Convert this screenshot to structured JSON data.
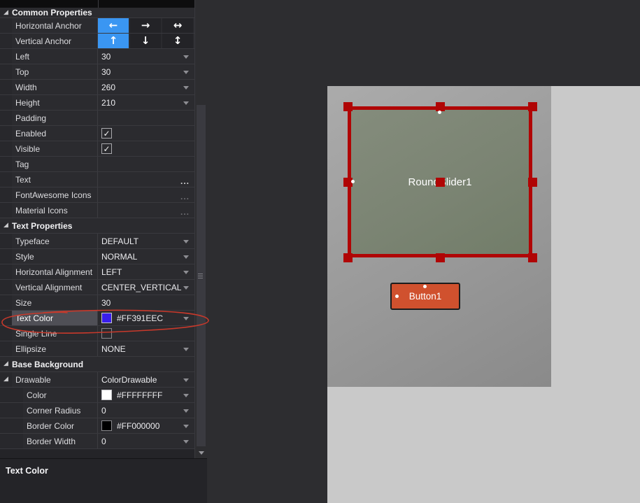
{
  "property_grid": {
    "sections": [
      {
        "label": "Common Properties",
        "rows": [
          {
            "label": "Horizontal Anchor",
            "type": "anchor",
            "buttons": [
              {
                "icon": "anchor-left",
                "glyph": "←",
                "selected": true
              },
              {
                "icon": "anchor-right",
                "glyph": "→",
                "selected": false
              },
              {
                "icon": "anchor-left-right",
                "glyph": "↔",
                "selected": false
              }
            ]
          },
          {
            "label": "Vertical Anchor",
            "type": "anchor",
            "buttons": [
              {
                "icon": "anchor-top",
                "glyph": "↑",
                "selected": true
              },
              {
                "icon": "anchor-bottom",
                "glyph": "↓",
                "selected": false
              },
              {
                "icon": "anchor-top-bottom",
                "glyph": "↕",
                "selected": false
              }
            ]
          },
          {
            "label": "Left",
            "type": "text",
            "value": "30",
            "dropdown": true
          },
          {
            "label": "Top",
            "type": "text",
            "value": "30",
            "dropdown": true
          },
          {
            "label": "Width",
            "type": "text",
            "value": "260",
            "dropdown": true
          },
          {
            "label": "Height",
            "type": "text",
            "value": "210",
            "dropdown": true
          },
          {
            "label": "Padding",
            "type": "empty"
          },
          {
            "label": "Enabled",
            "type": "checkbox",
            "checked": true
          },
          {
            "label": "Visible",
            "type": "checkbox",
            "checked": true
          },
          {
            "label": "Tag",
            "type": "empty"
          },
          {
            "label": "Text",
            "type": "ellipsis",
            "dim": false
          },
          {
            "label": "FontAwesome Icons",
            "type": "ellipsis",
            "dim": true
          },
          {
            "label": "Material Icons",
            "type": "ellipsis",
            "dim": true
          }
        ]
      },
      {
        "label": "Text Properties",
        "rows": [
          {
            "label": "Typeface",
            "type": "text",
            "value": "DEFAULT",
            "dropdown": true
          },
          {
            "label": "Style",
            "type": "text",
            "value": "NORMAL",
            "dropdown": true
          },
          {
            "label": "Horizontal Alignment",
            "type": "text",
            "value": "LEFT",
            "dropdown": true
          },
          {
            "label": "Vertical Alignment",
            "type": "text",
            "value": "CENTER_VERTICAL",
            "dropdown": true
          },
          {
            "label": "Size",
            "type": "text",
            "value": "30",
            "dropdown": false
          },
          {
            "label": "Text Color",
            "type": "color",
            "value": "#FF391EEC",
            "swatch": "#391EEC",
            "dropdown": true,
            "selected": true
          },
          {
            "label": "Single Line",
            "type": "checkbox",
            "checked": false
          },
          {
            "label": "Ellipsize",
            "type": "text",
            "value": "NONE",
            "dropdown": true
          }
        ]
      },
      {
        "label": "Base Background",
        "rows": [
          {
            "label": "Drawable",
            "type": "text",
            "value": "ColorDrawable",
            "dropdown": true,
            "expander": true
          },
          {
            "label": "Color",
            "type": "color",
            "value": "#FFFFFFFF",
            "swatch": "#FFFFFF",
            "dropdown": true,
            "indent": 1
          },
          {
            "label": "Corner Radius",
            "type": "text",
            "value": "0",
            "dropdown": true,
            "indent": 1
          },
          {
            "label": "Border Color",
            "type": "color",
            "value": "#FF000000",
            "swatch": "#000000",
            "dropdown": true,
            "indent": 1
          },
          {
            "label": "Border Width",
            "type": "text",
            "value": "0",
            "dropdown": true,
            "indent": 1
          }
        ]
      }
    ],
    "expander_glyph": "◢",
    "check_glyph": "✓",
    "ellipsis_glyph": "..."
  },
  "description_panel": {
    "text": "Text Color"
  },
  "canvas": {
    "controls": [
      {
        "label": "RoundSlider1",
        "type": "round-slider",
        "selected": true
      },
      {
        "label": "Button1",
        "type": "button"
      }
    ]
  },
  "colors": {
    "accent_blue": "#3a96f2",
    "selection_red": "#b00505",
    "annotation_red": "#c8392b",
    "button_orange": "#d0512e",
    "slider_fill": "#7b8473",
    "text_color_value": "#FF391EEC",
    "background_color_value": "#FFFFFFFF",
    "border_color_value": "#FF000000"
  }
}
